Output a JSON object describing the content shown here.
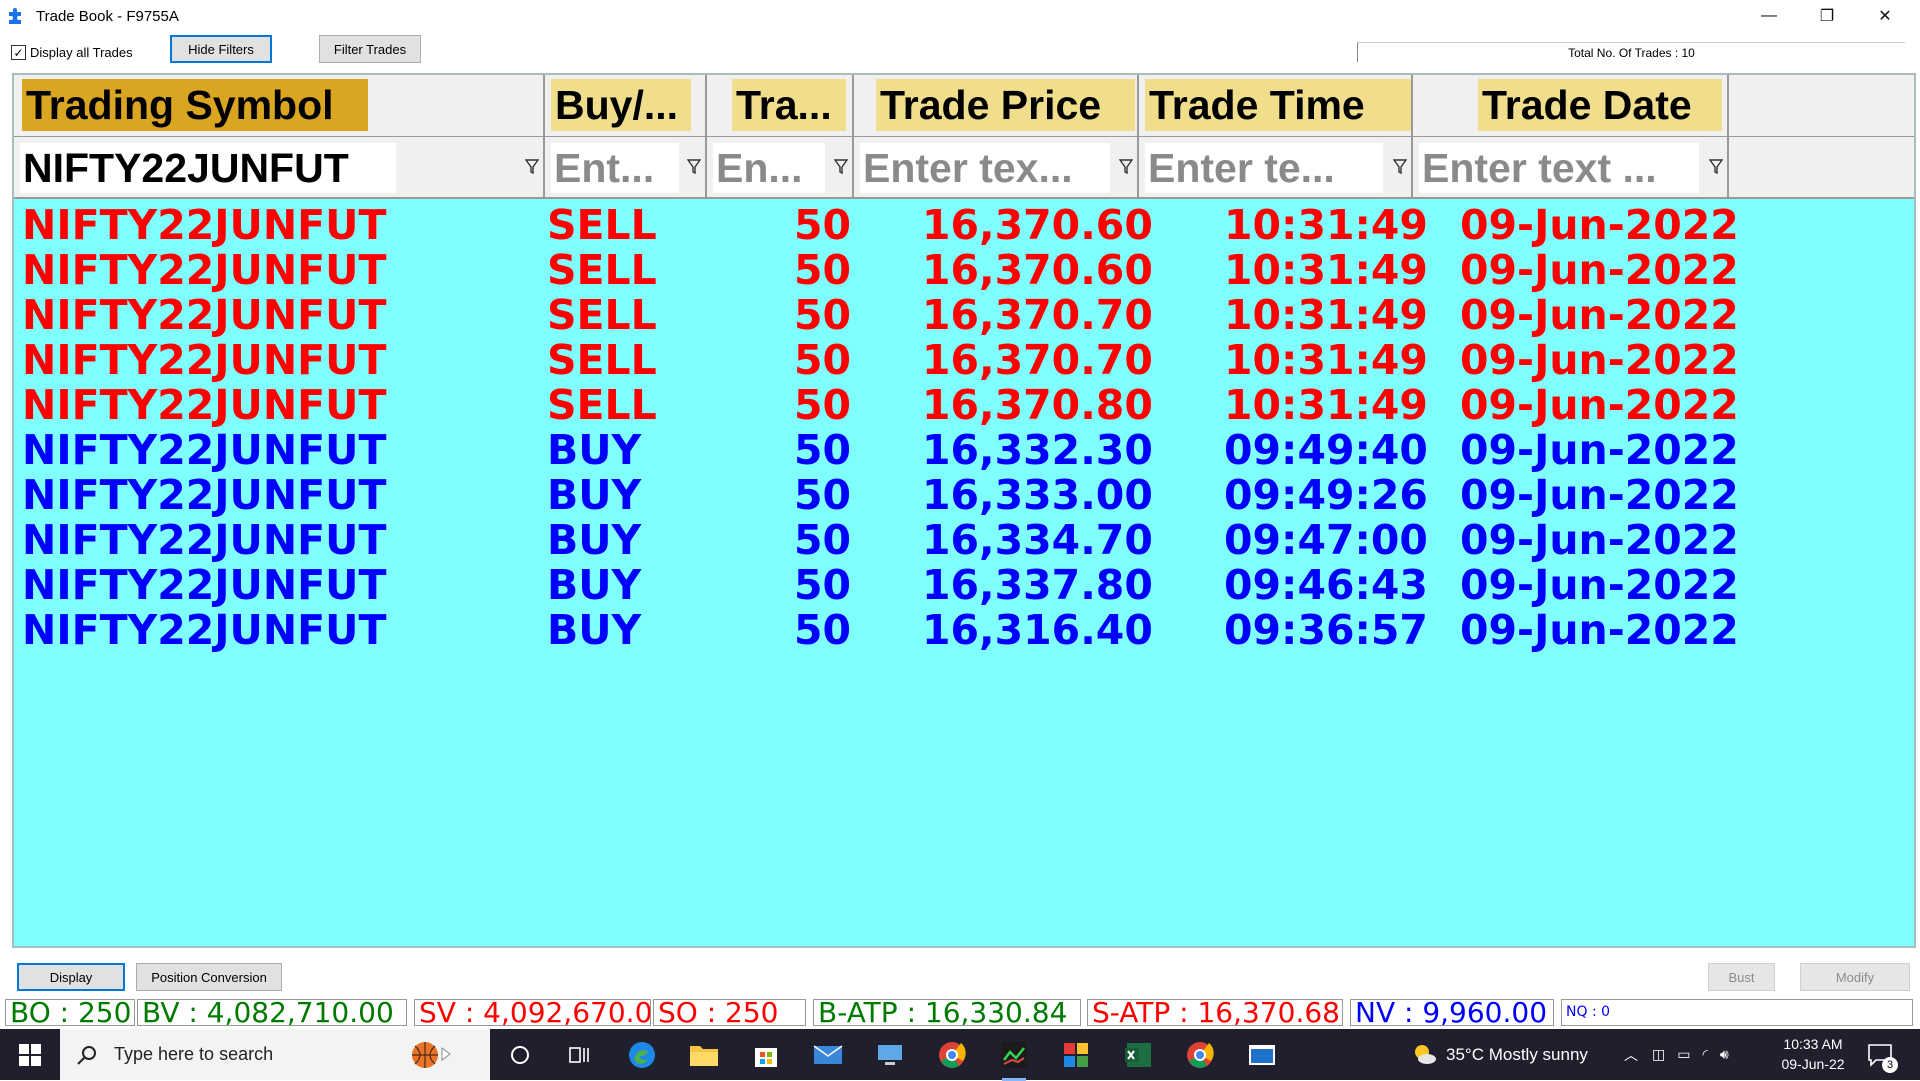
{
  "window": {
    "title": "Trade Book - F9755A",
    "minimize": "—",
    "restore": "❐",
    "close": "✕"
  },
  "toolbar": {
    "display_all_label": "Display all Trades",
    "display_all_checked": true,
    "hide_filters": "Hide Filters",
    "filter_trades": "Filter Trades",
    "total_trades": "Total No. Of Trades : 10"
  },
  "grid": {
    "columns": [
      "Trading Symbol",
      "Buy/...",
      "Tra...",
      "Trade Price",
      "Trade Time",
      "Trade Date"
    ],
    "filters": [
      "NIFTY22JUNFUT",
      "Ent...",
      "En...",
      "Enter tex...",
      "Enter te...",
      "Enter text ..."
    ],
    "rows": [
      {
        "symbol": "NIFTY22JUNFUT",
        "side": "SELL",
        "qty": "50",
        "price": "16,370.60",
        "time": "10:31:49",
        "date": "09-Jun-2022"
      },
      {
        "symbol": "NIFTY22JUNFUT",
        "side": "SELL",
        "qty": "50",
        "price": "16,370.60",
        "time": "10:31:49",
        "date": "09-Jun-2022"
      },
      {
        "symbol": "NIFTY22JUNFUT",
        "side": "SELL",
        "qty": "50",
        "price": "16,370.70",
        "time": "10:31:49",
        "date": "09-Jun-2022"
      },
      {
        "symbol": "NIFTY22JUNFUT",
        "side": "SELL",
        "qty": "50",
        "price": "16,370.70",
        "time": "10:31:49",
        "date": "09-Jun-2022"
      },
      {
        "symbol": "NIFTY22JUNFUT",
        "side": "SELL",
        "qty": "50",
        "price": "16,370.80",
        "time": "10:31:49",
        "date": "09-Jun-2022"
      },
      {
        "symbol": "NIFTY22JUNFUT",
        "side": "BUY",
        "qty": "50",
        "price": "16,332.30",
        "time": "09:49:40",
        "date": "09-Jun-2022"
      },
      {
        "symbol": "NIFTY22JUNFUT",
        "side": "BUY",
        "qty": "50",
        "price": "16,333.00",
        "time": "09:49:26",
        "date": "09-Jun-2022"
      },
      {
        "symbol": "NIFTY22JUNFUT",
        "side": "BUY",
        "qty": "50",
        "price": "16,334.70",
        "time": "09:47:00",
        "date": "09-Jun-2022"
      },
      {
        "symbol": "NIFTY22JUNFUT",
        "side": "BUY",
        "qty": "50",
        "price": "16,337.80",
        "time": "09:46:43",
        "date": "09-Jun-2022"
      },
      {
        "symbol": "NIFTY22JUNFUT",
        "side": "BUY",
        "qty": "50",
        "price": "16,316.40",
        "time": "09:36:57",
        "date": "09-Jun-2022"
      }
    ]
  },
  "bottom": {
    "display": "Display",
    "position_conversion": "Position Conversion",
    "bust": "Bust",
    "modify": "Modify"
  },
  "status": {
    "bo": "BO : 250",
    "bv": "BV : 4,082,710.00",
    "sv": "SV : 4,092,670.0",
    "so": "SO : 250",
    "batp": "B-ATP : 16,330.84",
    "satp": "S-ATP : 16,370.68",
    "nv": "NV : 9,960.00",
    "nq": "NQ : 0"
  },
  "taskbar": {
    "search_placeholder": "Type here to search",
    "weather": "35°C  Mostly sunny",
    "time": "10:33 AM",
    "date": "09-Jun-22",
    "notification_count": "3"
  },
  "colors": {
    "grid_bg": "#80ffff",
    "sell": "#ff0000",
    "buy": "#0000ff",
    "header_gold": "#daa520",
    "header_light": "#f0de8c"
  }
}
